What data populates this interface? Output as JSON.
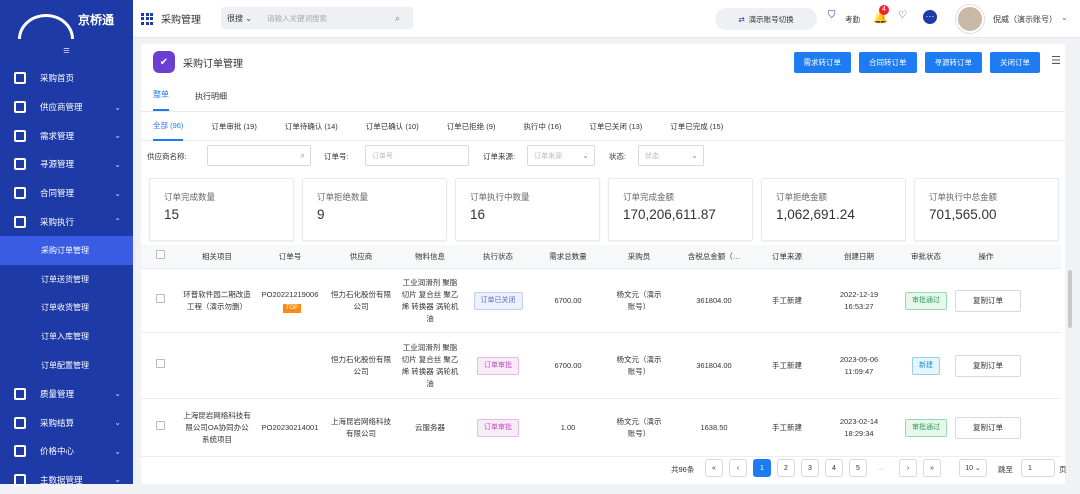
{
  "brand": {
    "name": "京桥通"
  },
  "sidebar": {
    "collapse_icon": "≡",
    "items": [
      {
        "label": "采购首页",
        "icon": "home-icon"
      },
      {
        "label": "供应商管理",
        "icon": "user-add-icon"
      },
      {
        "label": "需求管理",
        "icon": "edit-icon"
      },
      {
        "label": "寻源管理",
        "icon": "handshake-icon"
      },
      {
        "label": "合同管理",
        "icon": "contract-icon"
      },
      {
        "label": "采购执行",
        "icon": "clipboard-icon"
      },
      {
        "label": "质量管理",
        "icon": "shield-icon"
      },
      {
        "label": "采购结算",
        "icon": "money-bag-icon"
      },
      {
        "label": "价格中心",
        "icon": "price-icon"
      },
      {
        "label": "主数据管理",
        "icon": "database-icon"
      }
    ],
    "sub_items": [
      "采购订单管理",
      "订单送货管理",
      "订单收货管理",
      "订单入库管理",
      "订单配置管理"
    ]
  },
  "topbar": {
    "module": "采购管理",
    "search_select": "很搜",
    "search_placeholder": "请输入关键词搜索",
    "demo_switch": "演示账号切换",
    "kaoqin": "考勤",
    "notif_count": "4",
    "username": "倪威（演示账号）"
  },
  "page": {
    "title": "采购订单管理",
    "buttons": [
      "需求转订单",
      "合同转订单",
      "寻源转订单",
      "关闭订单"
    ],
    "tabs": [
      "整单",
      "执行明细"
    ],
    "status_tabs": [
      "全部 (96)",
      "订单审批 (19)",
      "订单待确认 (14)",
      "订单已确认 (10)",
      "订单已拒绝 (9)",
      "执行中 (16)",
      "订单已关闭 (13)",
      "订单已完成 (15)"
    ],
    "filters": {
      "supplier_label": "供应商名称:",
      "order_no_label": "订单号:",
      "order_no_placeholder": "订单号",
      "source_label": "订单来源:",
      "source_placeholder": "订单来源",
      "status_label": "状态:",
      "status_placeholder": "状态"
    },
    "stats": [
      {
        "label": "订单完成数量",
        "value": "15"
      },
      {
        "label": "订单拒绝数量",
        "value": "9"
      },
      {
        "label": "订单执行中数量",
        "value": "16"
      },
      {
        "label": "订单完成金额",
        "value": "170,206,611.87"
      },
      {
        "label": "订单拒绝金额",
        "value": "1,062,691.24"
      },
      {
        "label": "订单执行中总金额",
        "value": "701,565.00"
      }
    ]
  },
  "table": {
    "headers": [
      "相关项目",
      "订单号",
      "供应商",
      "物料信息",
      "执行状态",
      "需求总数量",
      "采购员",
      "含税总金额（…",
      "订单来源",
      "创建日期",
      "审批状态",
      "操作"
    ],
    "rows": [
      {
        "project": "环普软件园二期改造工程（演示勿删）",
        "order_no": "PO20221219006",
        "top": "TOP",
        "supplier": "恒力石化股份有限公司",
        "material": "工业润滑剂 聚脂切片 复合丝 聚乙烯 转换器 涡轮机油",
        "exec_status": "订单已关闭",
        "qty": "6700.00",
        "buyer": "杨文元（演示账号）",
        "amount": "361804.00",
        "source": "手工新建",
        "date": "2022-12-19 16:53:27",
        "approval": "审批通过",
        "op": "复制订单"
      },
      {
        "project": "",
        "order_no": "",
        "top": "",
        "supplier": "恒力石化股份有限公司",
        "material": "工业润滑剂 聚脂切片 复合丝 聚乙烯 转换器 涡轮机油",
        "exec_status": "订单审批",
        "qty": "6700.00",
        "buyer": "杨文元（演示账号）",
        "amount": "361804.00",
        "source": "手工新建",
        "date": "2023-05-06 11:09:47",
        "approval": "新建",
        "op": "复制订单"
      },
      {
        "project": "上海昆岩网络科技有限公司OA协同办公系统项目",
        "order_no": "PO20230214001",
        "top": "",
        "supplier": "上海昆岩网络科技有限公司",
        "material": "云服务器",
        "exec_status": "订单审批",
        "qty": "1.00",
        "buyer": "杨文元（演示账号）",
        "amount": "1638.50",
        "source": "手工新建",
        "date": "2023-02-14 18:29:34",
        "approval": "审批通过",
        "op": "复制订单"
      }
    ]
  },
  "pager": {
    "total": "共96条",
    "pages": [
      "1",
      "2",
      "3",
      "4",
      "5"
    ],
    "ellipsis": "···",
    "page_size": "10",
    "goto_label": "跳至",
    "goto_value": "1",
    "page_unit": "页"
  }
}
